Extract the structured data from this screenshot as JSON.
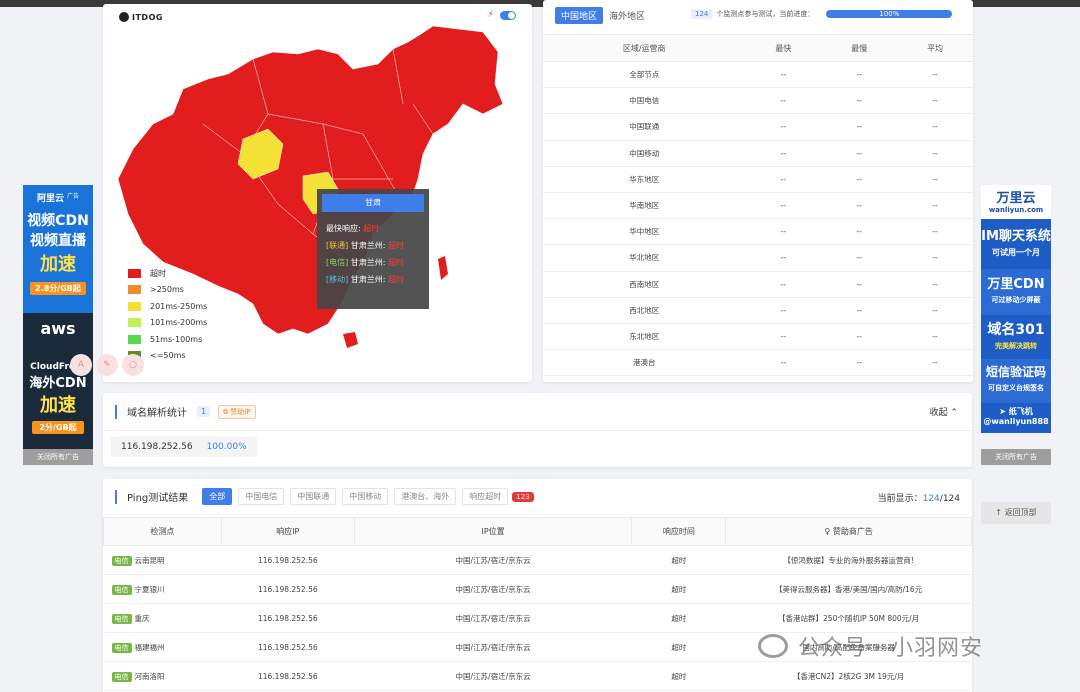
{
  "map": {
    "logo": "ITDOG",
    "legend": [
      {
        "label": "超时",
        "color": "#e11d1d"
      },
      {
        "label": ">250ms",
        "color": "#f08c2e"
      },
      {
        "label": "201ms-250ms",
        "color": "#f4e135"
      },
      {
        "label": "101ms-200ms",
        "color": "#c4ee5a"
      },
      {
        "label": "51ms-100ms",
        "color": "#58d84a"
      },
      {
        "label": "<=50ms",
        "color": "#5e8b2d"
      }
    ],
    "tooltip": {
      "province": "甘肃",
      "fastest_label": "最快响应:",
      "fastest_value": "超时",
      "rows": [
        {
          "isp": "[联通]",
          "city": "甘肃兰州:",
          "value": "超时"
        },
        {
          "isp": "[电信]",
          "city": "甘肃兰州:",
          "value": "超时"
        },
        {
          "isp": "[移动]",
          "city": "甘肃兰州:",
          "value": "超时"
        }
      ]
    }
  },
  "region": {
    "tab_active": "中国地区",
    "tab_other": "海外地区",
    "node_count": "124",
    "progress_text": "个监测点参与测试，当前进度：",
    "progress_value": "100%",
    "headers": [
      "区域/运营商",
      "最快",
      "最慢",
      "平均"
    ],
    "rows": [
      {
        "name": "全部节点",
        "fast": "--",
        "slow": "--",
        "avg": "--"
      },
      {
        "name": "中国电信",
        "fast": "--",
        "slow": "--",
        "avg": "--"
      },
      {
        "name": "中国联通",
        "fast": "--",
        "slow": "--",
        "avg": "--"
      },
      {
        "name": "中国移动",
        "fast": "--",
        "slow": "--",
        "avg": "--"
      },
      {
        "name": "华东地区",
        "fast": "--",
        "slow": "--",
        "avg": "--"
      },
      {
        "name": "华南地区",
        "fast": "--",
        "slow": "--",
        "avg": "--"
      },
      {
        "name": "华中地区",
        "fast": "--",
        "slow": "--",
        "avg": "--"
      },
      {
        "name": "华北地区",
        "fast": "--",
        "slow": "--",
        "avg": "--"
      },
      {
        "name": "西南地区",
        "fast": "--",
        "slow": "--",
        "avg": "--"
      },
      {
        "name": "西北地区",
        "fast": "--",
        "slow": "--",
        "avg": "--"
      },
      {
        "name": "东北地区",
        "fast": "--",
        "slow": "--",
        "avg": "--"
      },
      {
        "name": "港澳台",
        "fast": "--",
        "slow": "--",
        "avg": "--"
      }
    ]
  },
  "domain": {
    "title": "域名解析统计",
    "count": "1",
    "sponsor": "赞助IP",
    "collapse": "收起",
    "ip": "116.198.252.56",
    "percent": "100.00%"
  },
  "ping": {
    "title": "Ping测试结果",
    "filters": [
      "全部",
      "中国电信",
      "中国联通",
      "中国移动",
      "港澳台、海外",
      "响应超时"
    ],
    "timeout_count": "123",
    "current_label": "当前显示：",
    "current_shown": "124",
    "current_total": "/124",
    "headers": [
      "检测点",
      "响应IP",
      "IP位置",
      "响应时间",
      "赞助商广告"
    ],
    "rows": [
      {
        "tag": "电信",
        "loc": "云南昆明",
        "ip": "116.198.252.56",
        "place": "中国/江苏/宿迁/京东云",
        "time": "超时",
        "ad": "【惊鸿数据】专业的海外服务器运营商!"
      },
      {
        "tag": "电信",
        "loc": "宁夏银川",
        "ip": "116.198.252.56",
        "place": "中国/江苏/宿迁/京东云",
        "time": "超时",
        "ad": "【美得云服务器】香港/美国/国内/高防/16元"
      },
      {
        "tag": "电信",
        "loc": "重庆",
        "ip": "116.198.252.56",
        "place": "中国/江苏/宿迁/京东云",
        "time": "超时",
        "ad": "【香港站群】250个随机IP 50M 800元/月"
      },
      {
        "tag": "电信",
        "loc": "福建福州",
        "ip": "116.198.252.56",
        "place": "中国/江苏/宿迁/京东云",
        "time": "超时",
        "ad": "国内高防/高配免备案服务器"
      },
      {
        "tag": "电信",
        "loc": "河南洛阳",
        "ip": "116.198.252.56",
        "place": "中国/江苏/宿迁/京东云",
        "time": "超时",
        "ad": "【香港CN2】2核2G 3M 19元/月"
      }
    ]
  },
  "ads": {
    "left": {
      "brand": "阿里云",
      "tag": "广告",
      "line1": "视频CDN",
      "line2": "视频直播",
      "line3": "加速",
      "price": "2.8分/GB起",
      "brand2": "aws",
      "line4": "CloudFront",
      "line5": "海外CDN",
      "line6": "加速",
      "price2": "2分/GB起",
      "close": "关闭所有广告"
    },
    "right": {
      "brand": "万里云",
      "domain": "wanliyun.com",
      "line1": "IM聊天系统",
      "line1s": "可试用一个月",
      "line2": "万里CDN",
      "line2s": "可过移动少屏蔽",
      "line3": "域名301",
      "line3s": "完美解决跳转",
      "line4": "短信验证码",
      "line4s": "可自定义台规签名",
      "tg": "纸飞机",
      "tg_handle": "@wanliyun888",
      "close": "关闭所有广告"
    }
  },
  "back_top": "返回顶部",
  "watermark": "公众号 · 小羽网安"
}
